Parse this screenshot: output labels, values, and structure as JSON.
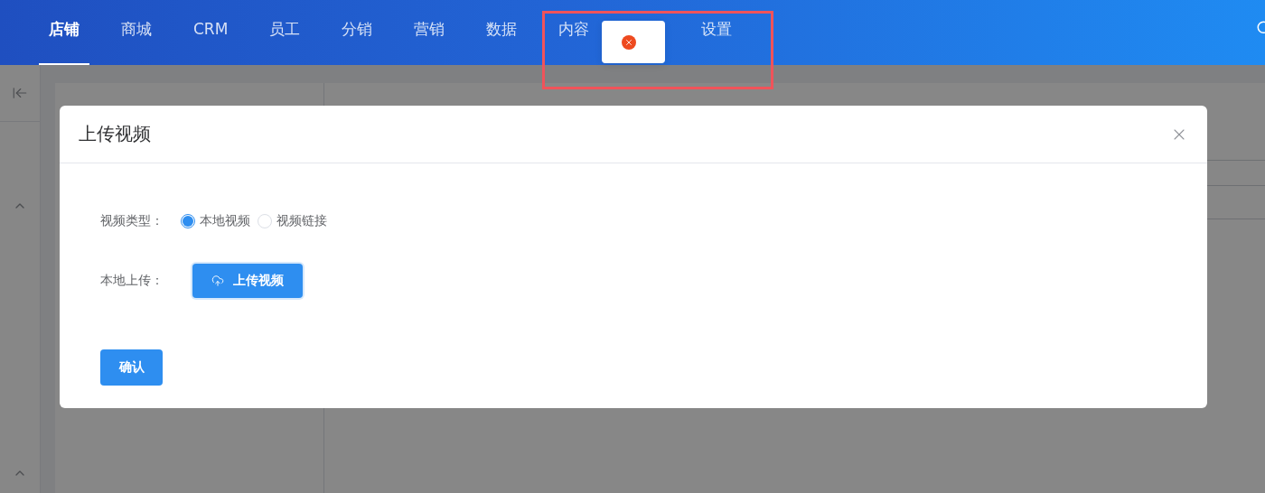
{
  "nav": {
    "tabs": [
      {
        "label": "店铺",
        "selected": true
      },
      {
        "label": "商城",
        "selected": false
      },
      {
        "label": "CRM",
        "selected": false
      },
      {
        "label": "员工",
        "selected": false
      },
      {
        "label": "分销",
        "selected": false
      },
      {
        "label": "营销",
        "selected": false
      },
      {
        "label": "数据",
        "selected": false
      },
      {
        "label": "内容",
        "selected": false
      },
      {
        "label": "设置",
        "selected": false
      }
    ]
  },
  "toast": {
    "kind": "error"
  },
  "modal": {
    "title": "上传视频",
    "rows": [
      {
        "kind": "radio",
        "label": "视频类型：",
        "options": [
          {
            "label": "本地视频",
            "selected": true
          },
          {
            "label": "视频链接",
            "selected": false
          }
        ]
      },
      {
        "kind": "upload",
        "label": "本地上传：",
        "button": "上传视频"
      }
    ],
    "confirm": "确认"
  }
}
